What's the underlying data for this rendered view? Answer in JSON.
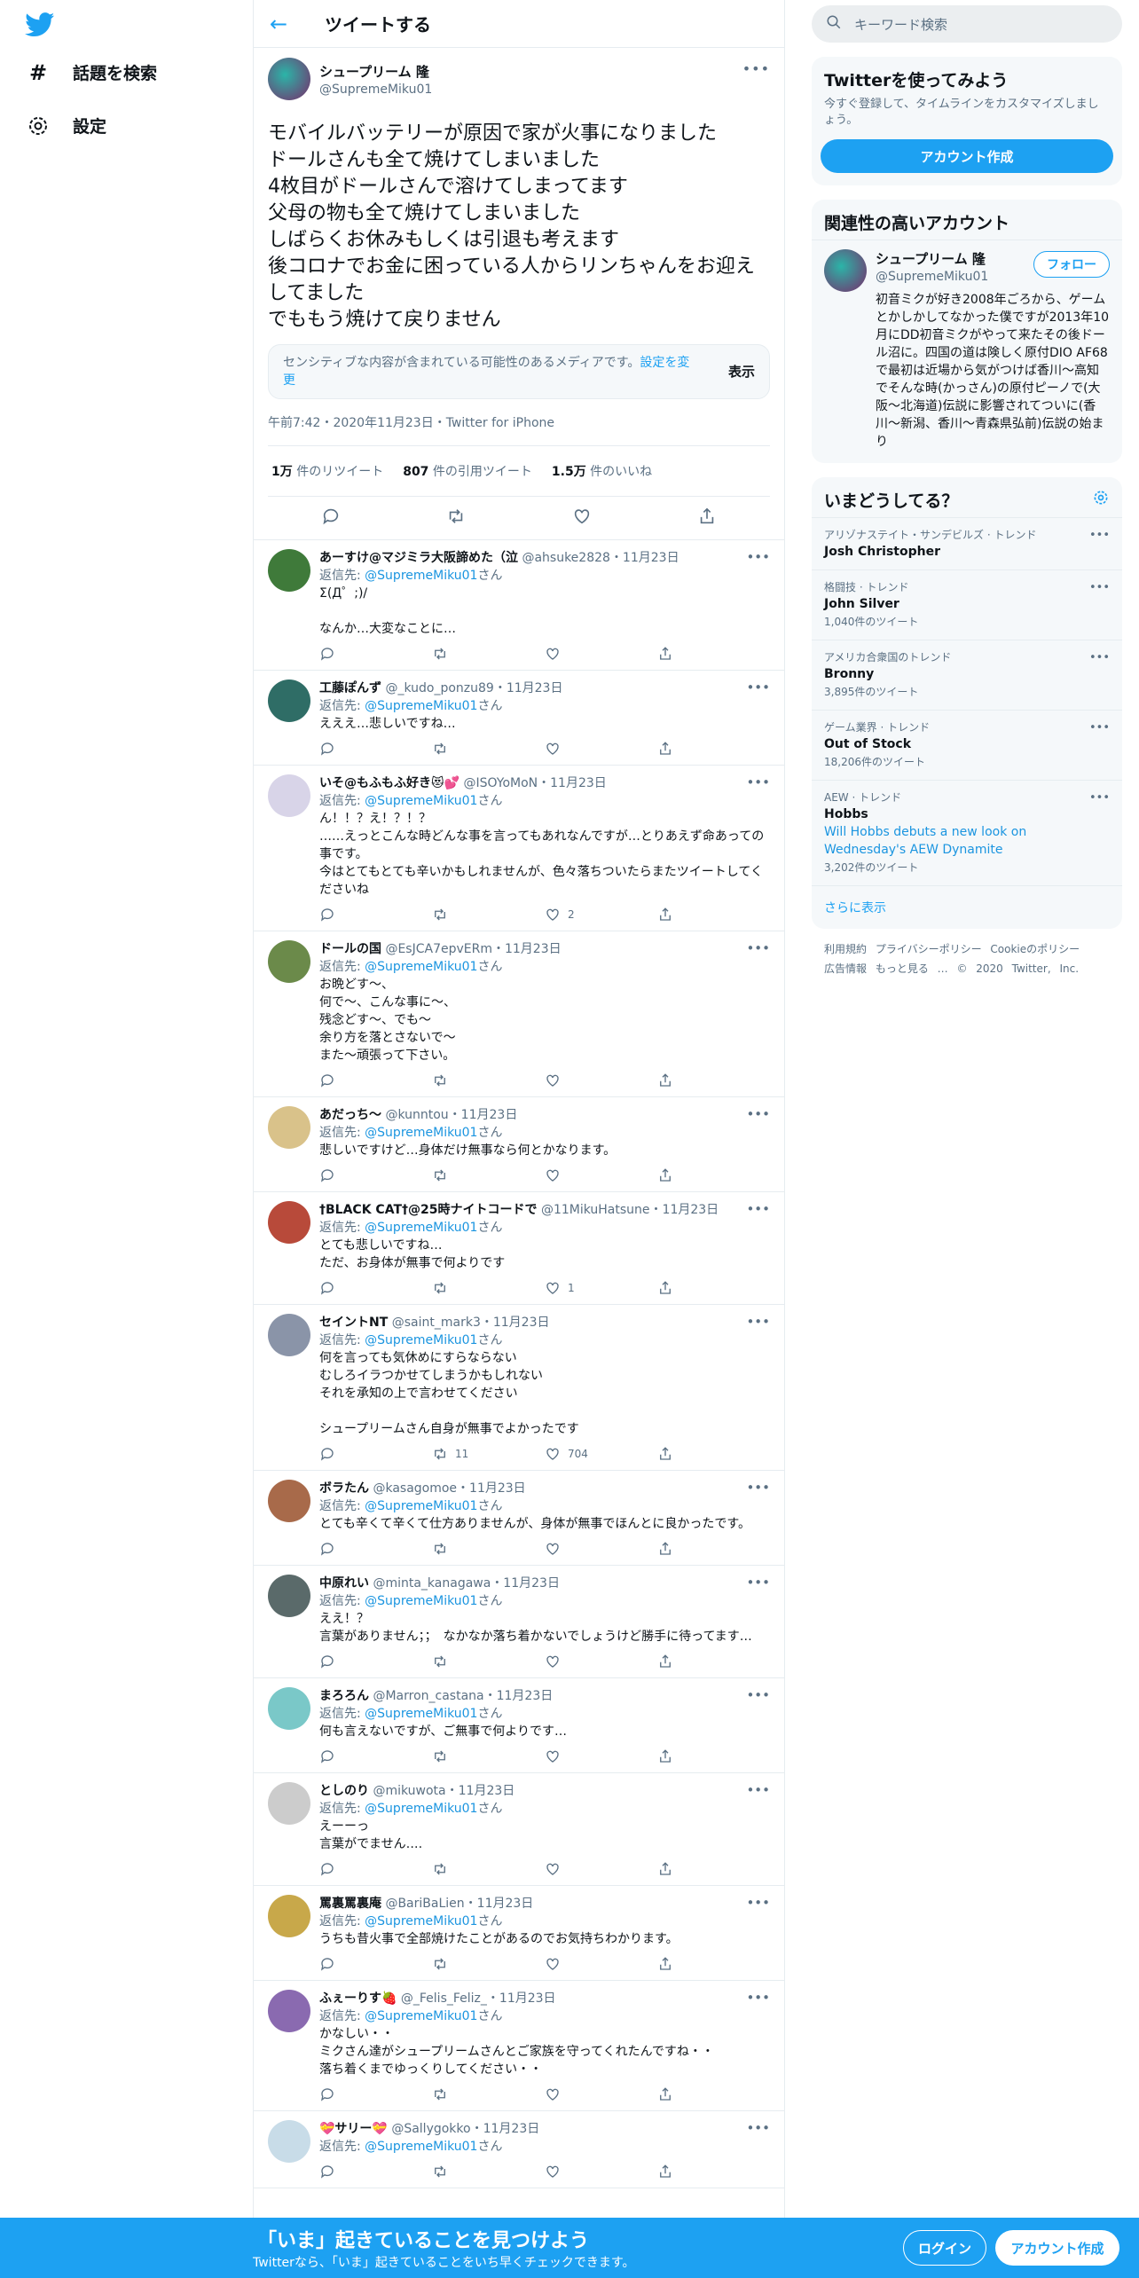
{
  "nav": {
    "explore": "話題を検索",
    "settings": "設定"
  },
  "header": {
    "title": "ツイートする"
  },
  "main_tweet": {
    "name": "シュープリーム 隆",
    "handle": "@SupremeMiku01",
    "text": "モバイルバッテリーが原因で家が火事になりました\nドールさんも全て焼けてしまいました\n4枚目がドールさんで溶けてしまってます\n父母の物も全て焼けてしまいました\nしばらくお休みもしくは引退も考えます\n後コロナでお金に困っている人からリンちゃんをお迎えしてました\nでももう焼けて戻りません",
    "sensitive_text": "センシティブな内容が含まれている可能性のあるメディアです。",
    "sensitive_link": "設定を変更",
    "sensitive_show": "表示",
    "meta": "午前7:42・2020年11月23日・Twitter for iPhone",
    "retweets_num": "1万",
    "retweets_label": " 件のリツイート",
    "quotes_num": "807",
    "quotes_label": " 件の引用ツイート",
    "likes_num": "1.5万",
    "likes_label": " 件のいいね"
  },
  "reply_to_handle": "@SupremeMiku01",
  "replies": [
    {
      "name": "あーすけ@マジミラ大阪諦めた（泣",
      "handle": "@ahsuke2828",
      "date": "・11月23日",
      "text": "Σ(Д゜;)/\n\nなんか…大変なことに…",
      "retweets": "",
      "likes": "",
      "color": "#3f7a3a"
    },
    {
      "name": "工藤ぽんず",
      "handle": "@_kudo_ponzu89",
      "date": "・11月23日",
      "text": "えええ…悲しいですね…",
      "retweets": "",
      "likes": "",
      "color": "#2f6d66"
    },
    {
      "name": "いそ@もふもふ好き😻💕",
      "handle": "@ISOYoMoN",
      "date": "・11月23日",
      "text": "ん！！？え！？！？\n……えっとこんな時どんな事を言ってもあれなんですが…とりあえず命あっての事です。\n今はとてもとても辛いかもしれませんが、色々落ちついたらまたツイートしてくださいね",
      "retweets": "",
      "likes": "2",
      "color": "#d8d4e8"
    },
    {
      "name": "ドールの国",
      "handle": "@EsJCA7epvERm",
      "date": "・11月23日",
      "text": "お晩どす～、\n何で～、こんな事に～、\n残念どす～、でも～\n余り方を落とさないで～\nまた～頑張って下さい。",
      "retweets": "",
      "likes": "",
      "color": "#6b8a4a"
    },
    {
      "name": "あだっち～",
      "handle": "@kunntou",
      "date": "・11月23日",
      "text": "悲しいですけど…身体だけ無事なら何とかなります。",
      "retweets": "",
      "likes": "",
      "color": "#d9c28a"
    },
    {
      "name": "†BLACK CAT†@25時ナイトコードで",
      "handle": "@11MikuHatsune",
      "date": "・11月23日",
      "text": "とても悲しいですね…\nただ、お身体が無事で何よりです",
      "retweets": "",
      "likes": "1",
      "color": "#b84a3a"
    },
    {
      "name": "セイントNT",
      "handle": "@saint_mark3",
      "date": "・11月23日",
      "text": "何を言っても気休めにすらならない\nむしろイラつかせてしまうかもしれない\nそれを承知の上で言わせてください\n\nシュープリームさん自身が無事でよかったです",
      "retweets": "11",
      "likes": "704",
      "color": "#8a94a8"
    },
    {
      "name": "ボラたん",
      "handle": "@kasagomoe",
      "date": "・11月23日",
      "text": "とても辛くて辛くて仕方ありませんが、身体が無事でほんとに良かったです。",
      "retweets": "",
      "likes": "",
      "color": "#a86a4a"
    },
    {
      "name": "中原れい",
      "handle": "@minta_kanagawa",
      "date": "・11月23日",
      "text": "ええ！？\n言葉がありません；；　なかなか落ち着かないでしょうけど勝手に待ってます…",
      "retweets": "",
      "likes": "",
      "color": "#5a6a6a"
    },
    {
      "name": "まろろん",
      "handle": "@Marron_castana",
      "date": "・11月23日",
      "text": "何も言えないですが、ご無事で何よりです…",
      "retweets": "",
      "likes": "",
      "color": "#7ac8c8"
    },
    {
      "name": "としのり",
      "handle": "@mikuwota",
      "date": "・11月23日",
      "text": "えーーっ\n言葉がでません‥‥",
      "retweets": "",
      "likes": "",
      "color": "#cccccc"
    },
    {
      "name": "罵裏罵裏庵",
      "handle": "@BariBaLien",
      "date": "・11月23日",
      "text": "うちも昔火事で全部焼けたことがあるのでお気持ちわかります。",
      "retweets": "",
      "likes": "",
      "color": "#c8a84a"
    },
    {
      "name": "ふぇーりす🍓",
      "handle": "@_Felis_Feliz_",
      "date": "・11月23日",
      "text": "かなしい・・\nミクさん達がシュープリームさんとご家族を守ってくれたんですね・・\n落ち着くまでゆっくりしてください・・",
      "retweets": "",
      "likes": "",
      "color": "#8a6ab0"
    },
    {
      "name": "💝サリー💝",
      "handle": "@Sallygokko",
      "date": "・11月23日",
      "text": "",
      "retweets": "",
      "likes": "",
      "color": "#c8dce8"
    }
  ],
  "reply_label": "返信先: ",
  "reply_suffix": "さん",
  "sidebar": {
    "search_placeholder": "キーワード検索",
    "signup_title": "Twitterを使ってみよう",
    "signup_text": "今すぐ登録して、タイムラインをカスタマイズしましょう。",
    "signup_button": "アカウント作成",
    "related_title": "関連性の高いアカウント",
    "related_name": "シュープリーム 隆",
    "related_handle": "@SupremeMiku01",
    "follow_button": "フォロー",
    "related_bio": "初音ミクが好き2008年ごろから、ゲームとかしかしてなかった僕ですが2013年10月にDD初音ミクがやって来たその後ドール沼に。四国の道は険しく原付DIO AF68で最初は近場から気がつけば香川〜高知でそんな時(かっさん)の原付ピーノで(大阪〜北海道)伝説に影響されてついに(香川〜新潟、香川〜青森県弘前)伝説の始まり",
    "trends_title": "いまどうしてる？",
    "trends": [
      {
        "context": "アリゾナステイト・サンデビルズ · トレンド",
        "name": "Josh Christopher",
        "desc": "",
        "count": ""
      },
      {
        "context": "格闘技 · トレンド",
        "name": "John Silver",
        "desc": "",
        "count": "1,040件のツイート"
      },
      {
        "context": "アメリカ合衆国のトレンド",
        "name": "Bronny",
        "desc": "",
        "count": "3,895件のツイート"
      },
      {
        "context": "ゲーム業界 · トレンド",
        "name": "Out of Stock",
        "desc": "",
        "count": "18,206件のツイート"
      },
      {
        "context": "AEW · トレンド",
        "name": "Hobbs",
        "desc": "Will Hobbs debuts a new look on Wednesday's AEW Dynamite",
        "count": "3,202件のツイート"
      }
    ],
    "show_more": "さらに表示",
    "footer_line1": "利用規約 プライバシーポリシー Cookieのポリシー",
    "footer_line2": "広告情報 もっと見る … © 2020 Twitter, Inc."
  },
  "banner": {
    "title": "「いま」起きていることを見つけよう",
    "subtitle": "Twitterなら、「いま」起きていることをいち早くチェックできます。",
    "login": "ログイン",
    "signup": "アカウント作成"
  },
  "colors": {
    "accent": "#1da1f2",
    "muted": "#5b7083",
    "border": "#e6ecf0"
  }
}
